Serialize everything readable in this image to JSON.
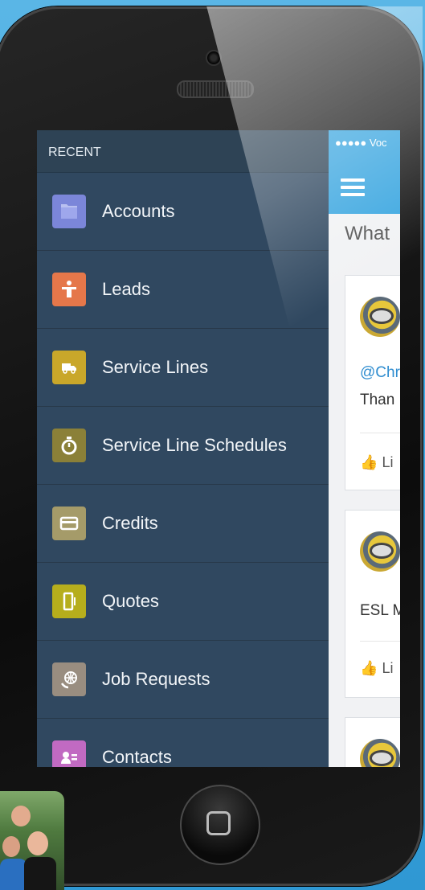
{
  "screen": {
    "menu": {
      "header": "RECENT",
      "items": [
        {
          "label": "Accounts",
          "icon": "folder-icon",
          "color": "#7b86d9"
        },
        {
          "label": "Leads",
          "icon": "person-icon",
          "color": "#e5774a"
        },
        {
          "label": "Service Lines",
          "icon": "truck-icon",
          "color": "#c9a72a"
        },
        {
          "label": "Service Line Schedules",
          "icon": "stopwatch-icon",
          "color": "#8b8038"
        },
        {
          "label": "Credits",
          "icon": "credit-card-icon",
          "color": "#a59b69"
        },
        {
          "label": "Quotes",
          "icon": "mobile-icon",
          "color": "#b6ae1c"
        },
        {
          "label": "Job Requests",
          "icon": "globe-phone-icon",
          "color": "#998d80"
        },
        {
          "label": "Contacts",
          "icon": "contact-card-icon",
          "color": "#c16ac2"
        }
      ]
    },
    "app": {
      "status_text": "●●●●● Voc",
      "title_partial": "What",
      "feed": [
        {
          "handle_partial": "@Chr",
          "text_partial": "Than",
          "like_partial": "Li"
        },
        {
          "text_partial": "ESL M",
          "like_partial": "Li"
        }
      ]
    }
  },
  "colors": {
    "menu_bg": "#304860",
    "accent_blue": "#3aa6e0",
    "link_blue": "#2f8dd0"
  }
}
